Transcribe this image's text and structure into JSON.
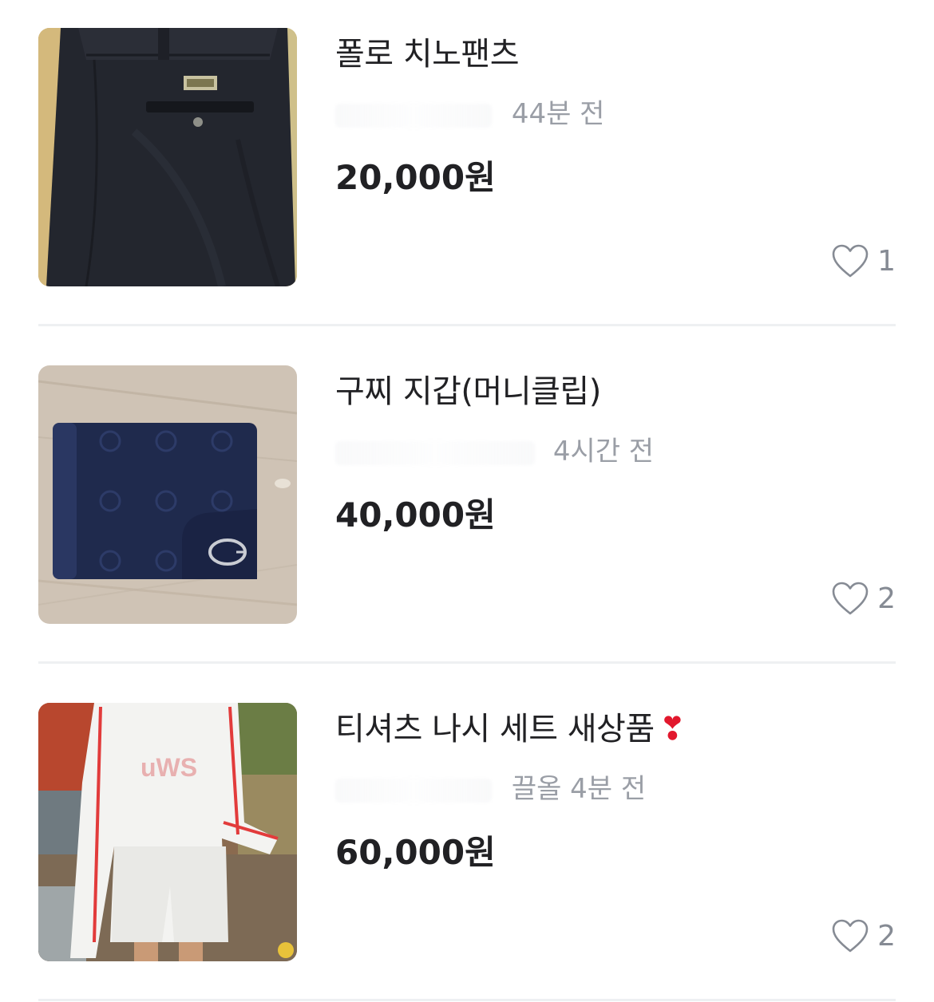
{
  "items": [
    {
      "title": "폴로 치노팬츠",
      "time": "44분 전",
      "price": "20,000원",
      "likes": "1",
      "image_desc": "navy chino pants"
    },
    {
      "title": "구찌 지갑(머니클립)",
      "time": "4시간 전",
      "price": "40,000원",
      "likes": "2",
      "image_desc": "navy monogram wallet"
    },
    {
      "title": "티셔츠 나시 세트 새상품",
      "title_emoji": "❣",
      "time": "끌올 4분 전",
      "price": "60,000원",
      "likes": "2",
      "image_desc": "white t-shirt and shorts set"
    }
  ],
  "colors": {
    "text": "#212124",
    "meta": "#9a9ea6",
    "like": "#868b94",
    "divider": "#eef0f2",
    "emoji": "#e2182d"
  },
  "icons": [
    "heart-outline-icon"
  ]
}
